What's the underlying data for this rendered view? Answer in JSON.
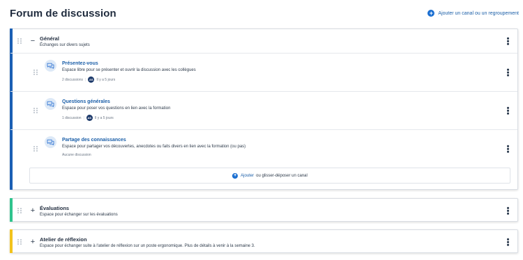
{
  "page": {
    "title": "Forum de discussion",
    "add_group_label": "Ajouter un canal ou un regroupement"
  },
  "colors": {
    "general_accent": "#1a5fb4",
    "evaluations_accent": "#2fc38d",
    "atelier_accent": "#f2c31c"
  },
  "groups": [
    {
      "title": "Général",
      "description": "Échanges sur divers sujets",
      "toggle": "−",
      "channels": [
        {
          "title": "Présentez-vous",
          "description": "Espace libre pour se présenter et ouvrir la discussion avec les collègues",
          "count": "2 discussions",
          "avatar": "AS",
          "time": "Il y a 5 jours"
        },
        {
          "title": "Questions générales",
          "description": "Espace pour poser vos questions en lien avec la formation",
          "count": "1 discussion",
          "avatar": "AS",
          "time": "Il y a 5 jours"
        },
        {
          "title": "Partage des connaissances",
          "description": "Espace pour partager vos découvertes, anecdotes ou faits divers en lien avec la formation (ou pas)",
          "count": "Aucune discussion"
        }
      ],
      "drop_zone": {
        "link": "Ajouter",
        "text": "ou glisser-déposer un canal"
      }
    },
    {
      "title": "Évaluations",
      "description": "Espace pour échanger sur les évaluations",
      "toggle": "+"
    },
    {
      "title": "Atelier de réflexion",
      "description": "Espace pour échanger suite à l'atelier de réflexion sur un poste ergonomique. Plus de détails à venir à la semaine 3.",
      "toggle": "+"
    }
  ],
  "icons": {
    "plus": "+",
    "chat": "chat-bubbles-icon",
    "drag": "drag-handle-icon",
    "more": "more-vertical-icon"
  }
}
